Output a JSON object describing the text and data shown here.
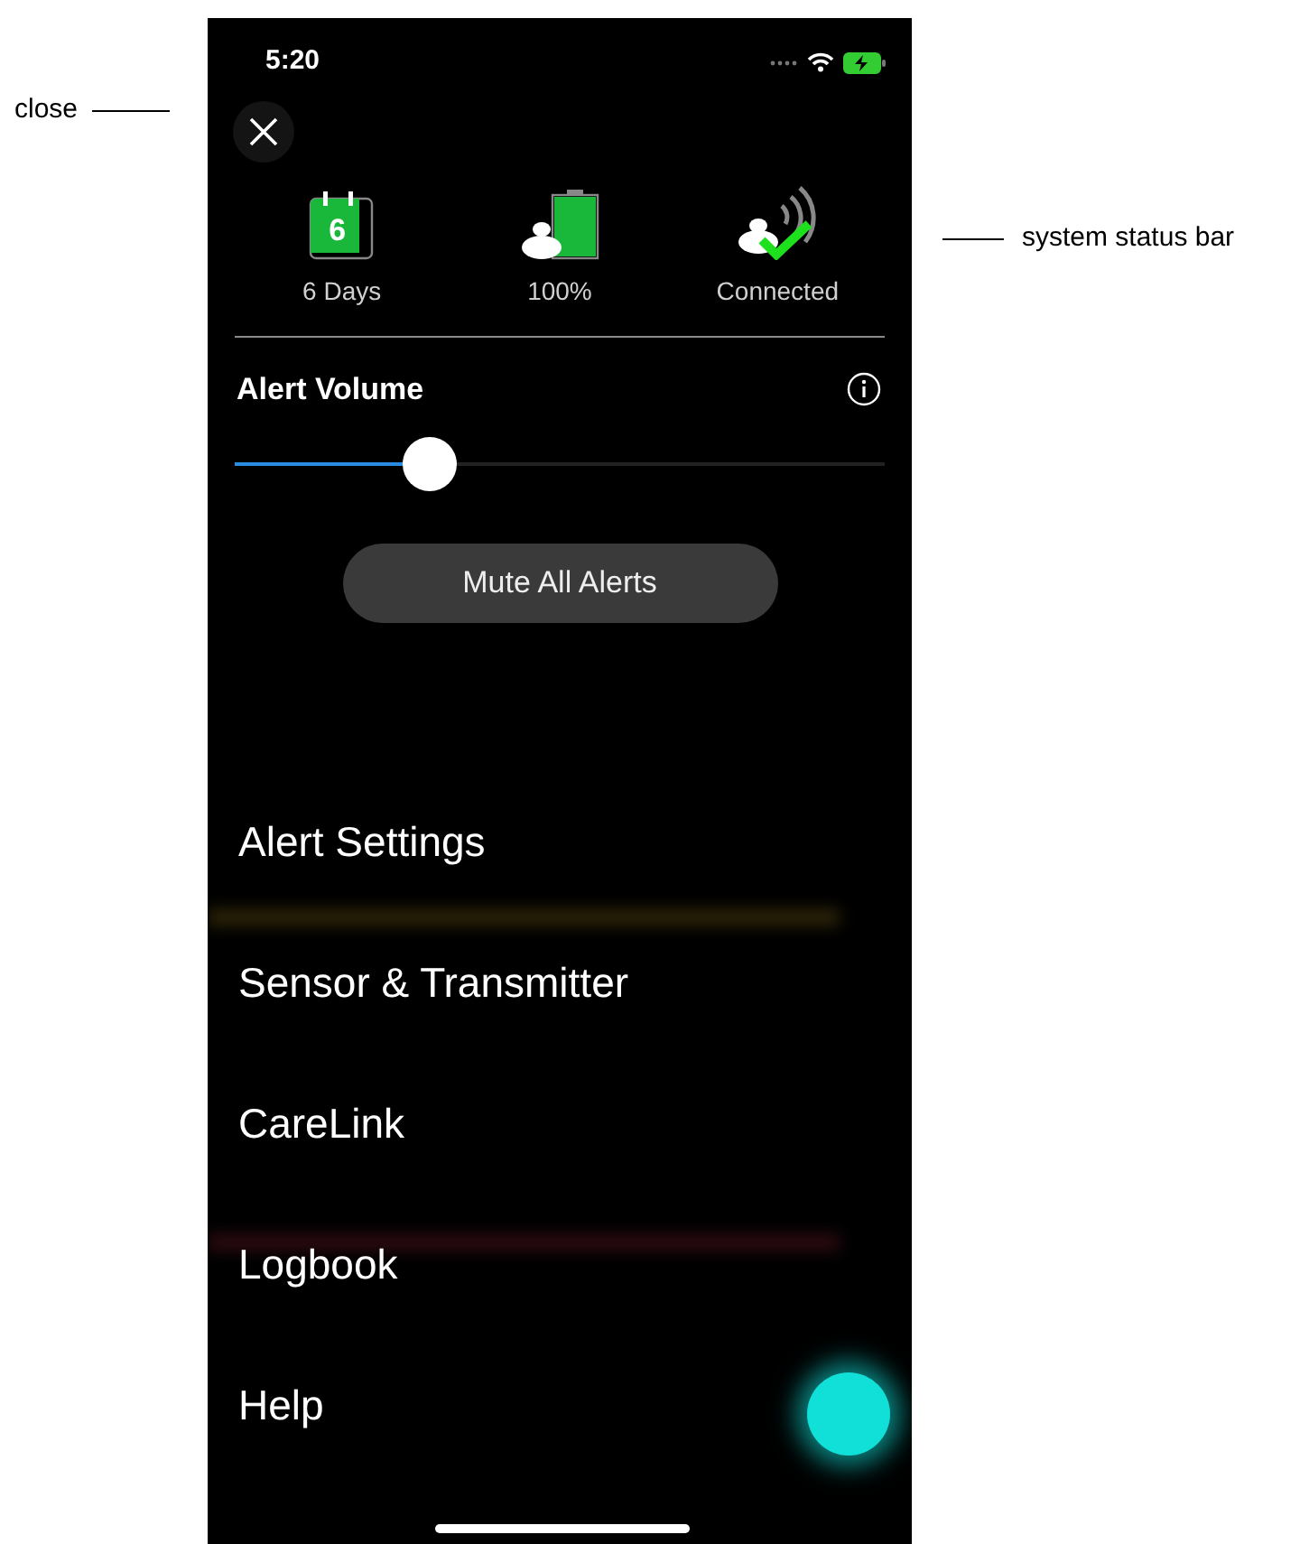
{
  "annotations": [
    {
      "kind": "left",
      "text": "close"
    },
    {
      "kind": "right",
      "text": "system status bar"
    }
  ],
  "status_bar": {
    "time": "5:20"
  },
  "system_status": [
    {
      "kind": "sensor-days",
      "label": "6 Days",
      "days": "6"
    },
    {
      "kind": "battery",
      "label": "100%",
      "level": 1
    },
    {
      "kind": "connection",
      "label": "Connected"
    }
  ],
  "alert_volume": {
    "label": "Alert Volume",
    "level": 0.3
  },
  "mute_button": "Mute All Alerts",
  "menu": [
    "Alert Settings",
    "Sensor & Transmitter",
    "CareLink",
    "Logbook",
    "Help"
  ]
}
